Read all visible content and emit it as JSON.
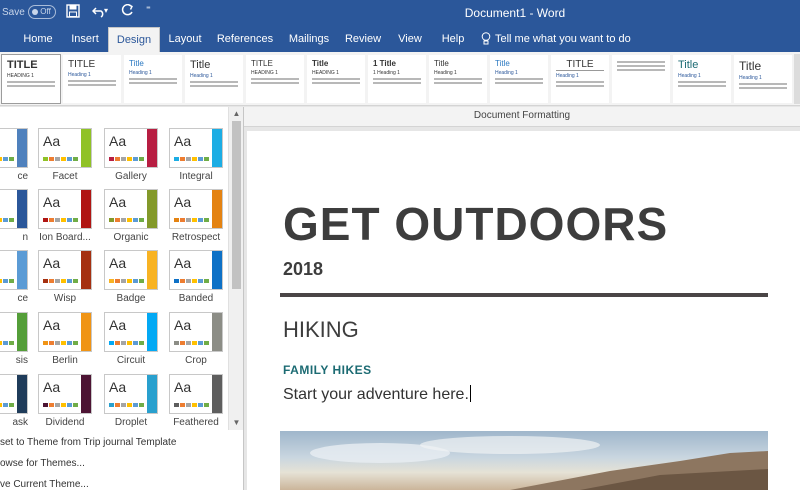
{
  "titlebar": {
    "autosave_label": "Save",
    "autosave_state": "Off",
    "doc_title": "Document1  -  Word",
    "qat": {
      "save_icon": "save-icon",
      "undo_icon": "undo-icon",
      "redo_icon": "redo-icon",
      "customize_icon": "customize-icon"
    }
  },
  "tabs": [
    {
      "label": "Home"
    },
    {
      "label": "Insert"
    },
    {
      "label": "Design",
      "active": true
    },
    {
      "label": "Layout"
    },
    {
      "label": "References"
    },
    {
      "label": "Mailings"
    },
    {
      "label": "Review"
    },
    {
      "label": "View"
    },
    {
      "label": "Help"
    }
  ],
  "tell_me": "Tell me what you want to do",
  "style_gallery": {
    "items": [
      {
        "title": "TITLE",
        "head": "HEADING 1"
      },
      {
        "title": "TITLE",
        "head": "Heading 1"
      },
      {
        "title": "Title",
        "head": "Heading 1"
      },
      {
        "title": "Title",
        "head": "Heading 1"
      },
      {
        "title": "TITLE",
        "head": "HEADING 1"
      },
      {
        "title": "Title",
        "head": "HEADING 1"
      },
      {
        "title": "1  Title",
        "head": "1  Heading 1"
      },
      {
        "title": "Title",
        "head": "Heading 1"
      },
      {
        "title": "Title",
        "head": "Heading 1"
      },
      {
        "title": "TITLE",
        "head": "Heading 1"
      },
      {
        "title": "",
        "head": ""
      },
      {
        "title": "Title",
        "head": "Heading 1"
      },
      {
        "title": "Title",
        "head": "Heading 1"
      }
    ]
  },
  "document_formatting_label": "Document Formatting",
  "themes": {
    "rows": [
      [
        {
          "name": "ce",
          "accent": "#4f81bd"
        },
        {
          "name": "Facet",
          "accent": "#90c226"
        },
        {
          "name": "Gallery",
          "accent": "#b71e42"
        },
        {
          "name": "Integral",
          "accent": "#1cade4"
        }
      ],
      [
        {
          "name": "n",
          "accent": "#2b579a"
        },
        {
          "name": "Ion Board...",
          "accent": "#b01513"
        },
        {
          "name": "Organic",
          "accent": "#83992a"
        },
        {
          "name": "Retrospect",
          "accent": "#e48312"
        }
      ],
      [
        {
          "name": "ce",
          "accent": "#5b9bd5"
        },
        {
          "name": "Wisp",
          "accent": "#a53010"
        },
        {
          "name": "Badge",
          "accent": "#f8b323"
        },
        {
          "name": "Banded",
          "accent": "#0e71c6"
        }
      ],
      [
        {
          "name": "sis",
          "accent": "#549e39"
        },
        {
          "name": "Berlin",
          "accent": "#f09415"
        },
        {
          "name": "Circuit",
          "accent": "#03a9f4"
        },
        {
          "name": "Crop",
          "accent": "#8c8d86"
        }
      ],
      [
        {
          "name": "ask",
          "accent": "#1f3c5a"
        },
        {
          "name": "Dividend",
          "accent": "#4d1434"
        },
        {
          "name": "Droplet",
          "accent": "#29a0ce"
        },
        {
          "name": "Feathered",
          "accent": "#5e5e5e"
        }
      ]
    ],
    "actions": [
      "set to Theme from Trip journal Template",
      "owse for Themes...",
      "ve Current Theme..."
    ]
  },
  "document": {
    "headline": "GET OUTDOORS",
    "year": "2018",
    "section": "HIKING",
    "subheading": "FAMILY HIKES",
    "body": "Start your adventure here."
  },
  "colors": {
    "word_blue": "#2b579a",
    "heading_dark": "#3d3d3d",
    "teal": "#1c6b73"
  }
}
